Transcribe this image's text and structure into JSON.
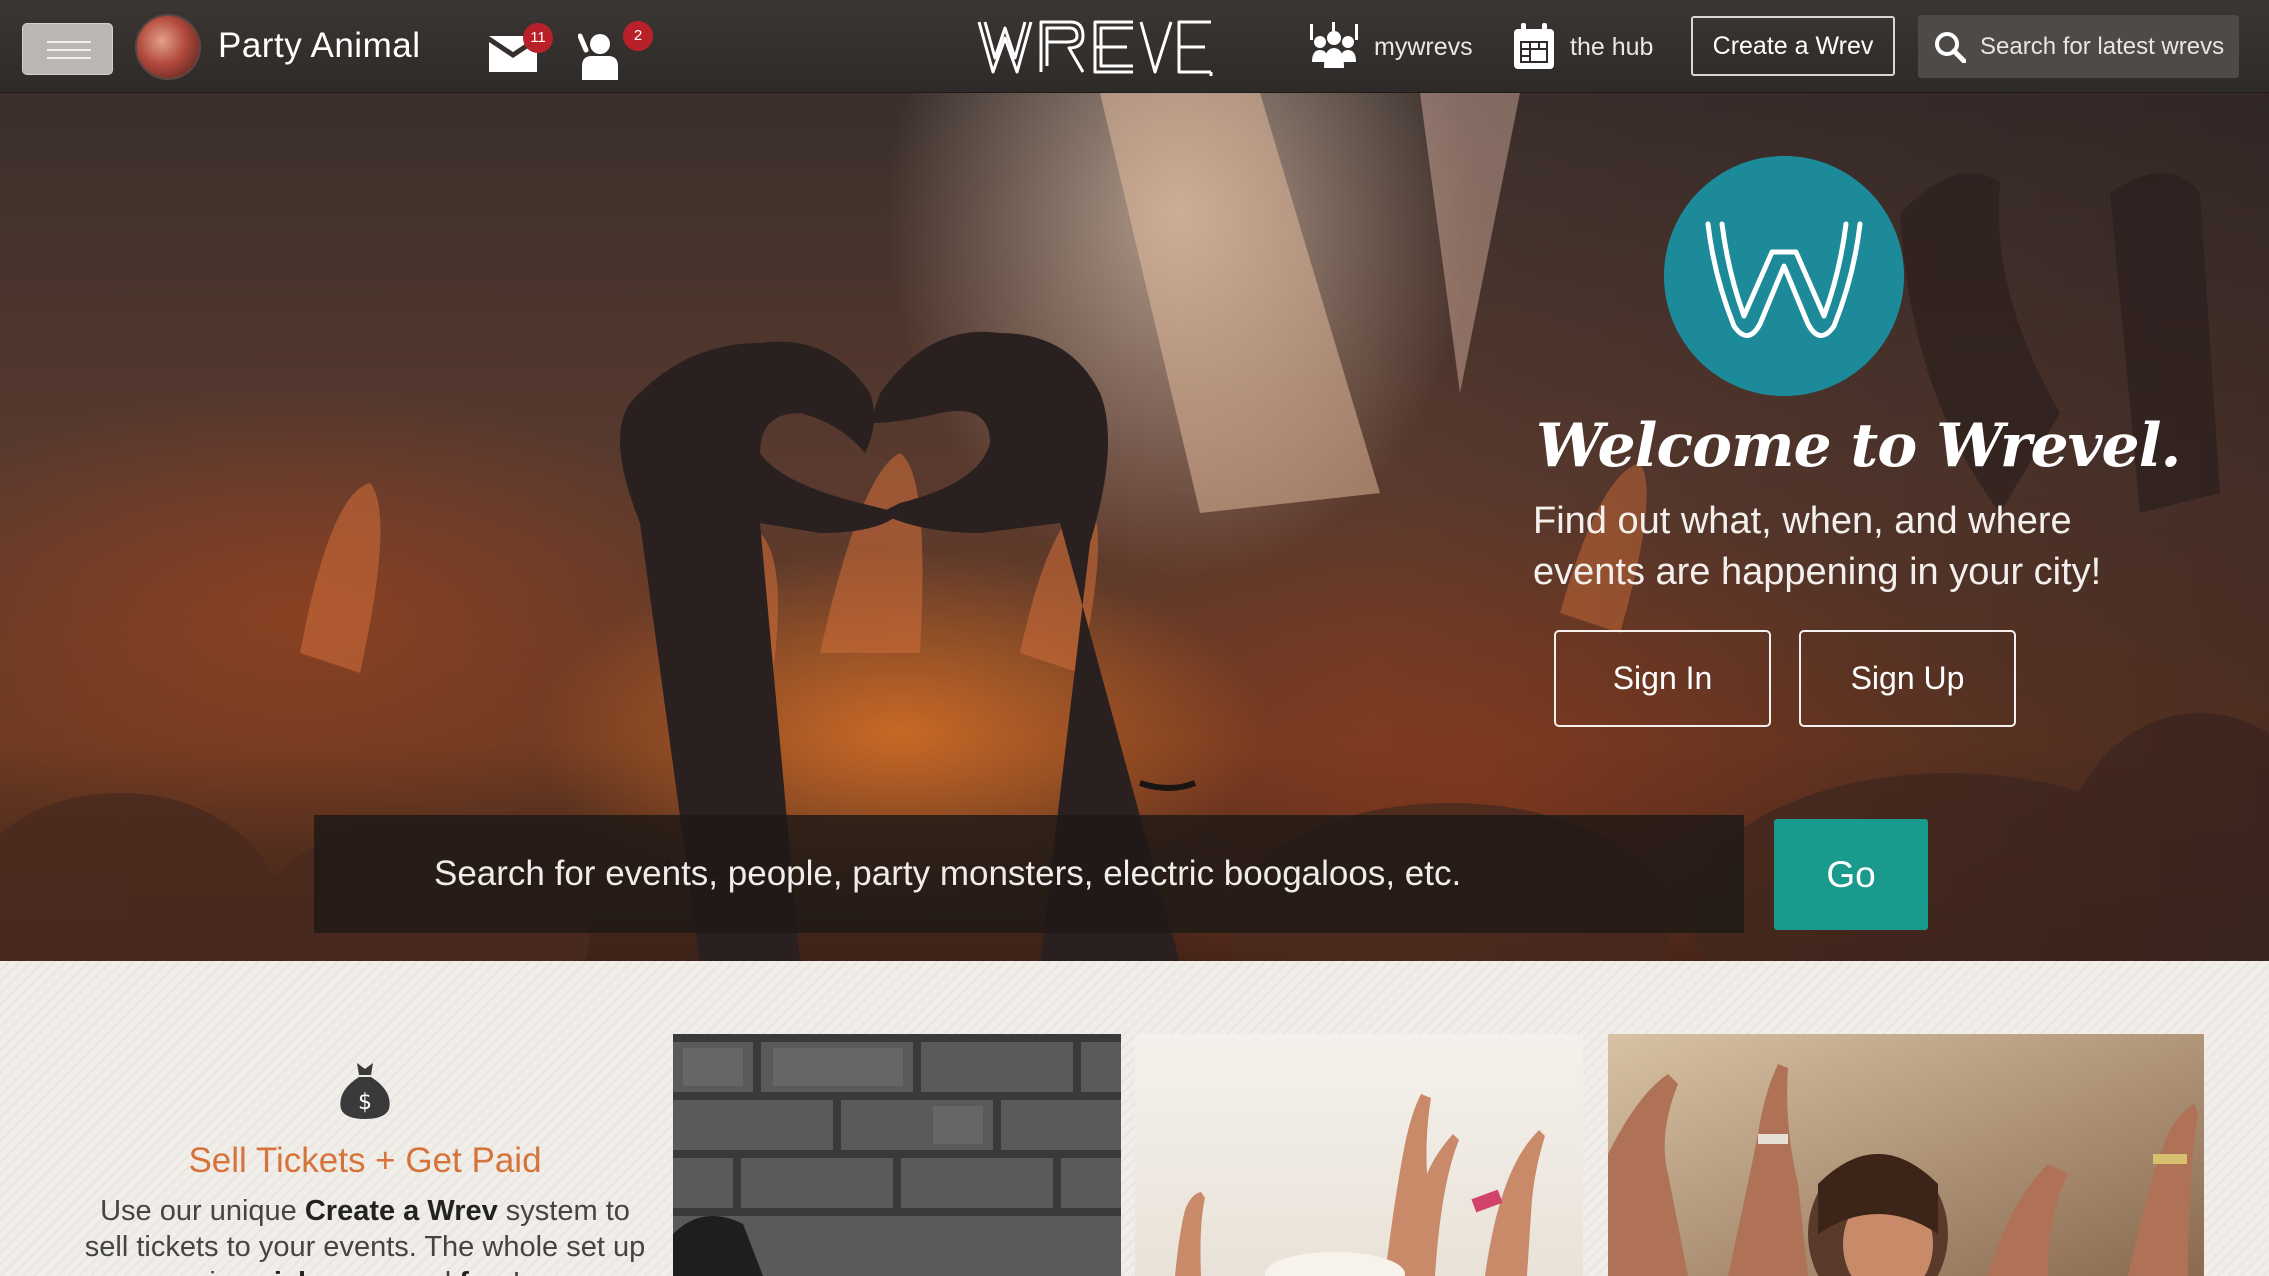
{
  "nav": {
    "username": "Party Animal",
    "messages_count": "11",
    "notifications_count": "2",
    "links": {
      "mywrevs": "mywrevs",
      "hub": "the hub"
    },
    "create_label": "Create a Wrev",
    "search_placeholder": "Search for latest wrevs"
  },
  "hero": {
    "welcome": "Welcome to Wrevel.",
    "tagline": "Find out what, when, and where events are happening in your city!",
    "sign_in": "Sign In",
    "sign_up": "Sign Up",
    "search_placeholder": "Search for events, people, party monsters, electric boogaloos, etc.",
    "go": "Go"
  },
  "feature": {
    "title": "Sell Tickets + Get Paid",
    "text_1": "Use our unique ",
    "text_bold_1": "Create a Wrev",
    "text_2": " system to sell tickets to your events. The whole set up is ",
    "text_bold_2": "quick, easy",
    "text_3": " and ",
    "text_bold_3": "free",
    "text_4": "!"
  },
  "colors": {
    "accent_teal": "#1a9a8c",
    "badge_teal": "#1d8a9a",
    "feature_orange": "#d6733a",
    "badge_red": "#b8202a"
  },
  "icons": [
    "menu-icon",
    "mail-icon",
    "friend-request-icon",
    "crowd-icon",
    "calendar-icon",
    "search-icon",
    "money-bag-icon",
    "wrevel-logo",
    "w-logo"
  ]
}
